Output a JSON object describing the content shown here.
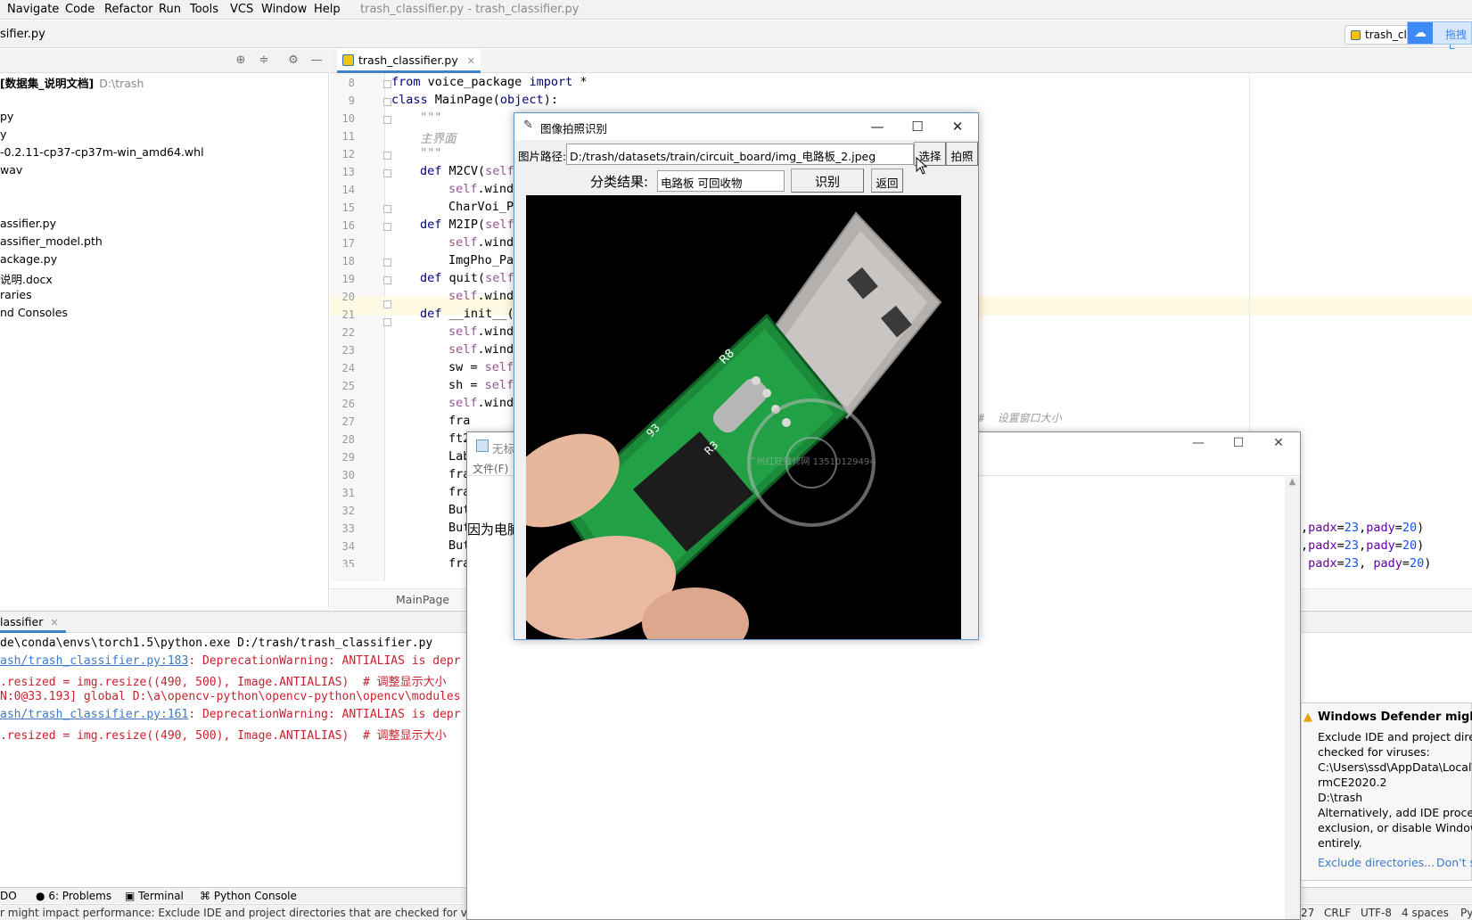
{
  "menubar": {
    "items": [
      "Navigate",
      "Code",
      "Refactor",
      "Run",
      "Tools",
      "VCS",
      "Window",
      "Help"
    ],
    "window_title": "trash_classifier.py - trash_classifier.py"
  },
  "navbar": {
    "file": "sifier.py",
    "run_config": "trash_cl",
    "cloud_text": "拖拽上"
  },
  "project": {
    "root_name": "[数据集_说明文档]",
    "root_path": "D:\\trash",
    "items": [
      "",
      "py",
      "y",
      "-0.2.11-cp37-cp37m-win_amd64.whl",
      "wav",
      "",
      "assifier.py",
      "assifier_model.pth",
      "ackage.py",
      "说明.docx",
      "raries",
      "nd Consoles"
    ]
  },
  "editor": {
    "tab_label": "trash_classifier.py",
    "line_numbers": [
      "8",
      "9",
      "10",
      "11",
      "12",
      "13",
      "14",
      "15",
      "16",
      "17",
      "18",
      "19",
      "20",
      "21",
      "22",
      "23",
      "24",
      "25",
      "26",
      "27",
      "28",
      "29",
      "30",
      "31",
      "32",
      "33",
      "34",
      "35"
    ],
    "breadcrumb": "MainPage",
    "comment_size": "#  设置窗口大小"
  },
  "run": {
    "tab": "lassifier",
    "lines": [
      {
        "pre": "de\\conda\\envs\\torch1.5\\python.exe D:/trash/trash_classifier.py",
        "link": "",
        "post": "",
        "err": false
      },
      {
        "pre": "",
        "link": "ash/trash_classifier.py:183",
        "post": ": DeprecationWarning: ANTIALIAS is depr",
        "err": true
      },
      {
        "pre": ".resized = img.resize((490, 500), Image.ANTIALIAS)  # 调整显示大小",
        "link": "",
        "post": "",
        "err": true
      },
      {
        "pre": "N:0@33.193] global D:\\a\\opencv-python\\opencv-python\\opencv\\modules",
        "link": "",
        "post": "",
        "err": true
      },
      {
        "pre": "",
        "link": "ash/trash_classifier.py:161",
        "post": ": DeprecationWarning: ANTIALIAS is depr",
        "err": true
      },
      {
        "pre": ".resized = img.resize((490, 500), Image.ANTIALIAS)  # 调整显示大小",
        "link": "",
        "post": "",
        "err": true
      }
    ]
  },
  "toolstrip": {
    "todo": "DO",
    "problems": "6: Problems",
    "terminal": "Terminal",
    "python_console": "Python Console"
  },
  "status": {
    "message": "r might impact performance: Exclude IDE and project directories that are checked for viru",
    "position": ":27",
    "line_sep": "CRLF",
    "encoding": "UTF-8",
    "indent": "4 spaces",
    "interpreter": "Py"
  },
  "notepad": {
    "title": "无标",
    "menu": "文件(F)",
    "text": "因为电脑"
  },
  "defender": {
    "title": "Windows Defender might im",
    "body": [
      "Exclude IDE and project direct",
      "checked for viruses:",
      "C:\\Users\\ssd\\AppData\\Local\\J",
      "rmCE2020.2",
      "D:\\trash",
      "Alternatively, add IDE process",
      "exclusion, or disable Windows",
      "entirely."
    ],
    "link_exclude": "Exclude directories...",
    "link_dont": "Don't s"
  },
  "dialog": {
    "title": "图像拍照识别",
    "path_label": "图片路径:",
    "path_value": "D:/trash/datasets/train/circuit_board/img_电路板_2.jpeg",
    "choose_button": "选择",
    "photo_button": "拍照",
    "result_label": "分类结果:",
    "result_value": "电路板 可回收物",
    "recognize_button": "识别",
    "back_button": "返回",
    "stamp_text": "广州红旺维修网 13510129494",
    "pcb_label_1": "R8",
    "pcb_label_2": "93",
    "pcb_label_3": "R3"
  },
  "colors": {
    "keyword": "#000080",
    "self": "#94558d",
    "accent": "#4083c9",
    "error_text": "#c7222d",
    "link": "#3e78c9"
  }
}
